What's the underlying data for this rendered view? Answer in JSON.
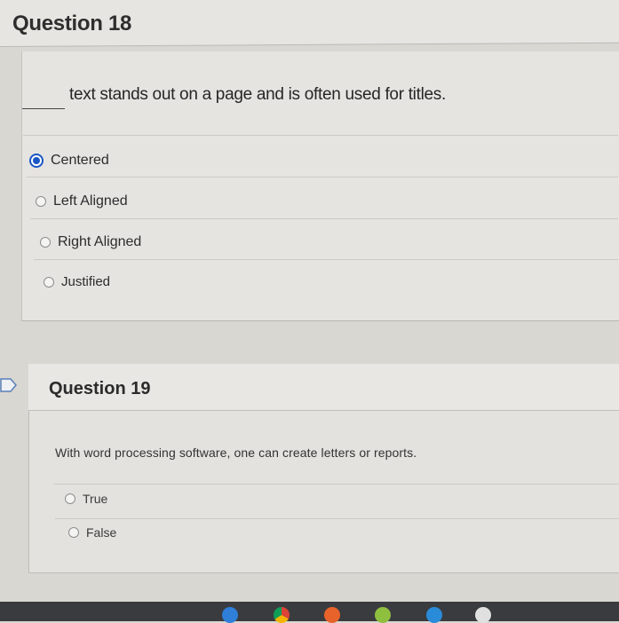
{
  "q18": {
    "title": "Question 18",
    "prompt": "text stands out on a page and is often used for titles.",
    "options": [
      {
        "label": "Centered",
        "selected": true
      },
      {
        "label": "Left Aligned",
        "selected": false
      },
      {
        "label": "Right Aligned",
        "selected": false
      },
      {
        "label": "Justified",
        "selected": false
      }
    ]
  },
  "q19": {
    "title": "Question 19",
    "prompt": "With word processing software, one can create letters or reports.",
    "options": [
      {
        "label": "True",
        "selected": false
      },
      {
        "label": "False",
        "selected": false
      }
    ]
  },
  "colors": {
    "accent": "#1a56c4",
    "background": "#e5e4e1"
  },
  "dock": {
    "icons": [
      "app-icon",
      "chrome-icon",
      "app-icon",
      "app-icon",
      "app-icon",
      "app-icon"
    ]
  }
}
